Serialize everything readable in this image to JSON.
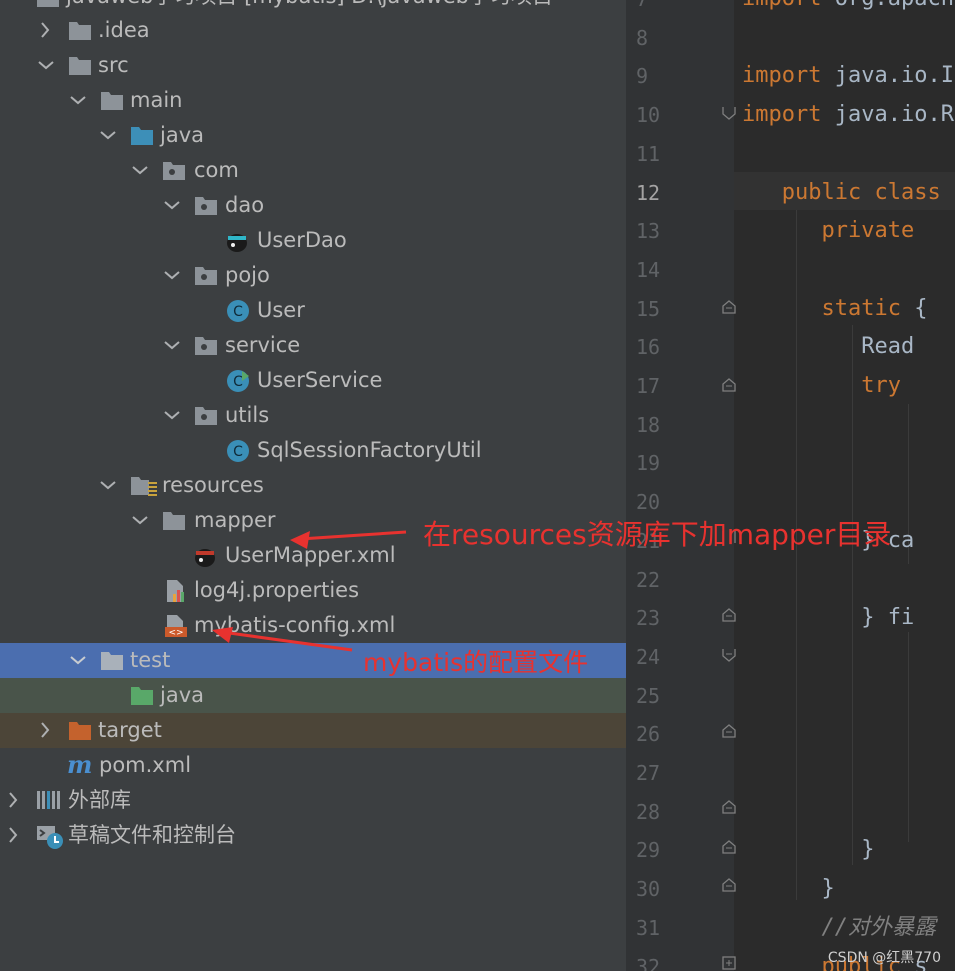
{
  "project": {
    "root_label_partial": "javaweb学习项目 [mybatis]  D:\\javaweb学习项目",
    "tree": [
      {
        "label": ".idea"
      },
      {
        "label": "src"
      },
      {
        "label": "main"
      },
      {
        "label": "java"
      },
      {
        "label": "com"
      },
      {
        "label": "dao"
      },
      {
        "label": "UserDao"
      },
      {
        "label": "pojo"
      },
      {
        "label": "User"
      },
      {
        "label": "service"
      },
      {
        "label": "UserService"
      },
      {
        "label": "utils"
      },
      {
        "label": "SqlSessionFactoryUtil"
      },
      {
        "label": "resources"
      },
      {
        "label": "mapper"
      },
      {
        "label": "UserMapper.xml"
      },
      {
        "label": "log4j.properties"
      },
      {
        "label": "mybatis-config.xml"
      },
      {
        "label": "test"
      },
      {
        "label": "java"
      },
      {
        "label": "target"
      },
      {
        "label": "pom.xml"
      },
      {
        "label": "外部库"
      },
      {
        "label": "草稿文件和控制台"
      }
    ]
  },
  "editor": {
    "current_line": 12,
    "lines": [
      {
        "num": "7",
        "code": "import org.apach"
      },
      {
        "num": "8",
        "code": ""
      },
      {
        "num": "9",
        "code": "import java.io.I"
      },
      {
        "num": "10",
        "code": "import java.io.R"
      },
      {
        "num": "11",
        "code": ""
      },
      {
        "num": "12",
        "code": "   public class"
      },
      {
        "num": "13",
        "code": "      private"
      },
      {
        "num": "14",
        "code": ""
      },
      {
        "num": "15",
        "code": "      static {"
      },
      {
        "num": "16",
        "code": "         Read"
      },
      {
        "num": "17",
        "code": "         try"
      },
      {
        "num": "18",
        "code": ""
      },
      {
        "num": "19",
        "code": ""
      },
      {
        "num": "20",
        "code": ""
      },
      {
        "num": "21",
        "code": "         } ca"
      },
      {
        "num": "22",
        "code": ""
      },
      {
        "num": "23",
        "code": "         } fi"
      },
      {
        "num": "24",
        "code": ""
      },
      {
        "num": "25",
        "code": ""
      },
      {
        "num": "26",
        "code": ""
      },
      {
        "num": "27",
        "code": ""
      },
      {
        "num": "28",
        "code": ""
      },
      {
        "num": "29",
        "code": "         }"
      },
      {
        "num": "30",
        "code": "      }"
      },
      {
        "num": "31",
        "code": "      //对外暴露"
      },
      {
        "num": "32",
        "code": "      public s"
      }
    ]
  },
  "annotations": {
    "mapper_note": "在resources资源库下加mapper目录",
    "config_note": "mybatis的配置文件",
    "color": "#e8322f"
  },
  "watermark": "CSDN @红黑770",
  "colors": {
    "tree_bg": "#3c3f41",
    "selected_row": "#4b6eaf",
    "test_row": "#49544a",
    "target_row": "#4c4538",
    "editor_bg": "#2b2b2b",
    "keyword": "#cc7832"
  }
}
